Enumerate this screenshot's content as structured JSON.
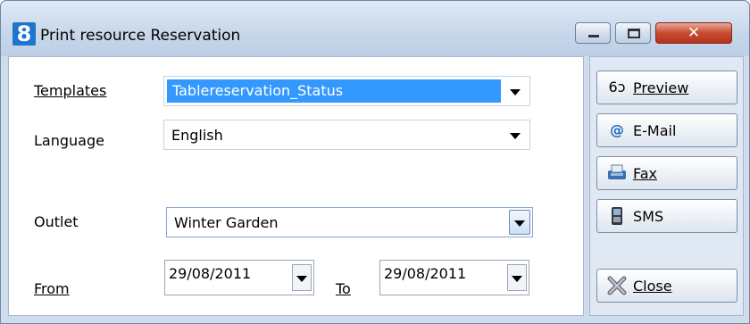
{
  "window": {
    "title": "Print resource Reservation",
    "app_icon_text": "8",
    "controls": {
      "minimize": "minimize",
      "maximize": "maximize",
      "close": "✕"
    }
  },
  "form": {
    "templates": {
      "label": "Templates",
      "value": "Tablereservation_Status"
    },
    "language": {
      "label": "Language",
      "value": "English"
    },
    "outlet": {
      "label": "Outlet",
      "value": "Winter Garden"
    },
    "from": {
      "label": "From",
      "value": "29/08/2011"
    },
    "to": {
      "label": "To",
      "value": "29/08/2011"
    }
  },
  "buttons": {
    "preview": {
      "label": "Preview",
      "icon": "glasses-icon"
    },
    "email": {
      "label": "E-Mail",
      "icon": "at-icon"
    },
    "fax": {
      "label": "Fax",
      "icon": "fax-icon"
    },
    "sms": {
      "label": "SMS",
      "icon": "phone-icon"
    },
    "close": {
      "label": "Close",
      "icon": "close-icon"
    }
  },
  "colors": {
    "selection": "#3399ff",
    "window_bg": "#cfdcec",
    "close_button": "#c94b32"
  }
}
